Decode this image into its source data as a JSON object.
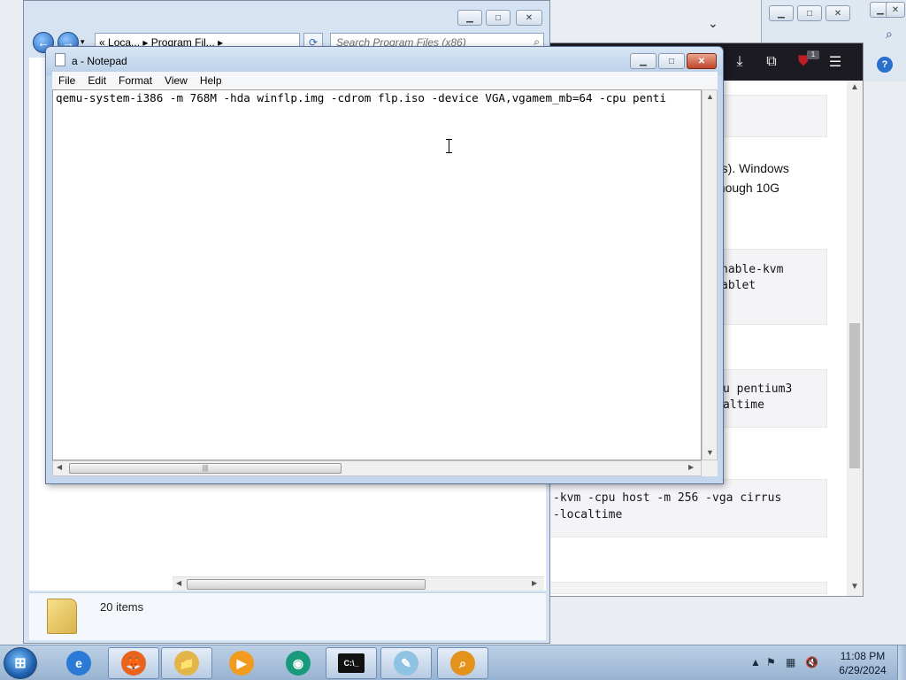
{
  "ie_window": {
    "help_icon": "help-icon",
    "search_icon": "search-icon"
  },
  "firefox": {
    "toolbar_icons": [
      "download-icon",
      "extensions-icon",
      "ublock-icon",
      "menu-icon"
    ],
    "ublock_badge": "1",
    "paragraph_lines": [
      "ytes). Windows",
      " although 10G"
    ],
    "code_blocks": [
      [
        "nable-kvm",
        "ablet"
      ],
      [
        "u pentium3",
        "altime"
      ],
      [
        "-kvm -cpu host -m 256 -vga cirrus",
        " -localtime"
      ]
    ]
  },
  "explorer": {
    "address_segments": [
      "«",
      "Loca...",
      "▸",
      "Program Fil...",
      "▸"
    ],
    "search_placeholder": "Search Program Files (x86)",
    "item_count": "20 items"
  },
  "notepad": {
    "title": "a - Notepad",
    "menu": [
      "File",
      "Edit",
      "Format",
      "View",
      "Help"
    ],
    "text": "qemu-system-i386 -m 768M -hda winflp.img -cdrom flp.iso -device VGA,vgamem_mb=64 -cpu penti"
  },
  "taskbar": {
    "start_label": "Start",
    "apps": [
      {
        "name": "internet-explorer",
        "glyph": "e",
        "color": "#2a7ad6",
        "active": false
      },
      {
        "name": "firefox",
        "glyph": "🦊",
        "color": "#e8641d",
        "active": true
      },
      {
        "name": "windows-explorer",
        "glyph": "📁",
        "color": "#e1b54a",
        "active": true
      },
      {
        "name": "media-player",
        "glyph": "▶",
        "color": "#f29c1f",
        "active": false
      },
      {
        "name": "app-green",
        "glyph": "◉",
        "color": "#1a9a7c",
        "active": false
      },
      {
        "name": "command-prompt",
        "glyph": "C:\\_",
        "color": "#111111",
        "active": true
      },
      {
        "name": "notepad",
        "glyph": "✎",
        "color": "#8fc3e3",
        "active": true
      },
      {
        "name": "search-tool",
        "glyph": "⌕",
        "color": "#e3931c",
        "active": true
      }
    ],
    "time": "11:08 PM",
    "date": "6/29/2024"
  }
}
